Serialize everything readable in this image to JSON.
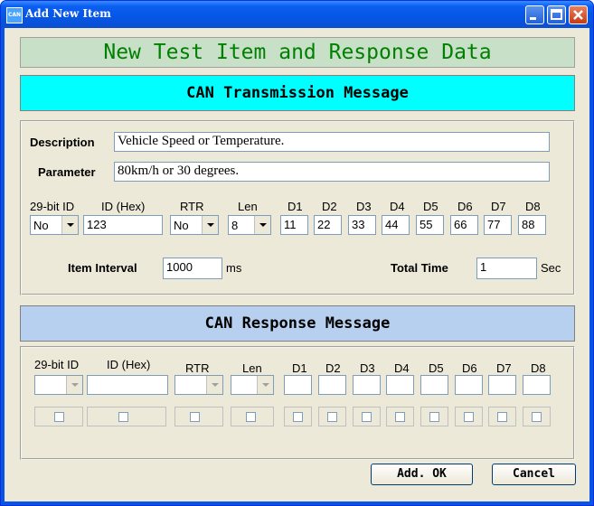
{
  "window": {
    "app_icon_text": "CAN",
    "title": "Add New Item"
  },
  "banner": "New Test Item and Response Data",
  "transmission": {
    "header": "CAN Transmission Message",
    "description_label": "Description",
    "description_value": "Vehicle Speed or Temperature.",
    "parameter_label": "Parameter",
    "parameter_value": "80km/h or 30 degrees.",
    "columns": [
      "29-bit ID",
      "ID (Hex)",
      "RTR",
      "Len",
      "D1",
      "D2",
      "D3",
      "D4",
      "D5",
      "D6",
      "D7",
      "D8"
    ],
    "id29_value": "No",
    "id_hex_value": "123",
    "rtr_value": "No",
    "len_value": "8",
    "data_values": [
      "11",
      "22",
      "33",
      "44",
      "55",
      "66",
      "77",
      "88"
    ],
    "item_interval_label": "Item Interval",
    "item_interval_value": "1000",
    "item_interval_unit": "ms",
    "total_time_label": "Total  Time",
    "total_time_value": "1",
    "total_time_unit": "Sec"
  },
  "response": {
    "header": "CAN Response Message",
    "columns": [
      "29-bit ID",
      "ID (Hex)",
      "RTR",
      "Len",
      "D1",
      "D2",
      "D3",
      "D4",
      "D5",
      "D6",
      "D7",
      "D8"
    ],
    "id_hex_value": "",
    "data_values": [
      "",
      "",
      "",
      "",
      "",
      "",
      "",
      ""
    ]
  },
  "buttons": {
    "ok": "Add. OK",
    "cancel": "Cancel"
  }
}
